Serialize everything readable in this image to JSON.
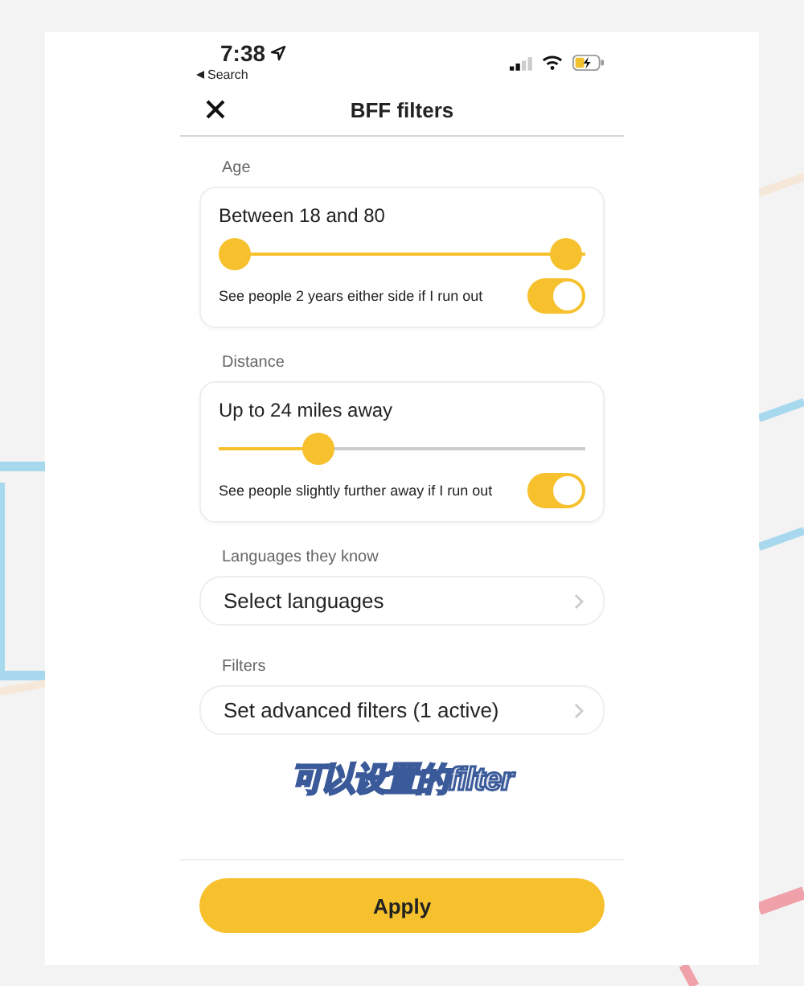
{
  "status_bar": {
    "time": "7:38",
    "back_link": "Search"
  },
  "header": {
    "title": "BFF filters"
  },
  "sections": [
    {
      "label": "Age",
      "kind": "range",
      "value_text": "Between 18 and 80",
      "low_thumb": {
        "level": 0
      },
      "high_thumb": {
        "level": 1
      },
      "toggle": {
        "label": "See people 2 years either side if I run out",
        "on": true
      }
    },
    {
      "label": "Distance",
      "kind": "slider",
      "value_text": "Up to 24 miles away",
      "level": 0.25,
      "toggle": {
        "label": "See people slightly further away if I run out",
        "on": true
      }
    },
    {
      "label": "Languages they know",
      "kind": "link",
      "value_text": "Select languages"
    },
    {
      "label": "Filters",
      "kind": "link",
      "value_text": "Set advanced filters (1 active)"
    }
  ],
  "caption": "可以设置的filter",
  "apply_button": "Apply"
}
